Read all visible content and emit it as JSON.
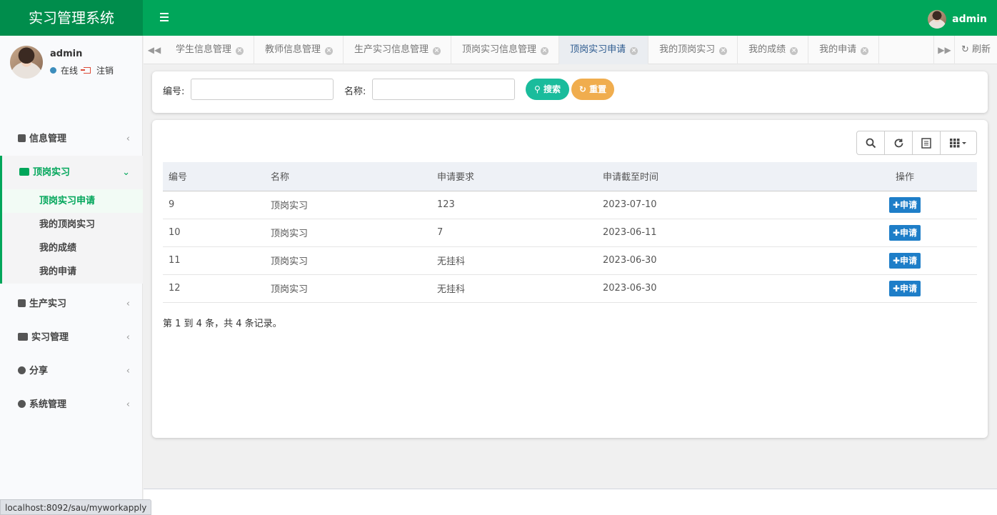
{
  "app": {
    "title": "实习管理系统"
  },
  "header": {
    "username": "admin"
  },
  "user_panel": {
    "name": "admin",
    "online": "在线",
    "logout": "注销"
  },
  "menu": {
    "info": "信息管理",
    "dingang": "顶岗实习",
    "dingang_sub": [
      "顶岗实习申请",
      "我的顶岗实习",
      "我的成绩",
      "我的申请"
    ],
    "shengchan": "生产实习",
    "shixi": "实习管理",
    "share": "分享",
    "system": "系统管理"
  },
  "tabs": [
    "学生信息管理",
    "教师信息管理",
    "生产实习信息管理",
    "顶岗实习信息管理",
    "顶岗实习申请",
    "我的顶岗实习",
    "我的成绩",
    "我的申请"
  ],
  "tab_refresh": "刷新",
  "search": {
    "id_label": "编号:",
    "name_label": "名称:",
    "id_value": "",
    "name_value": "",
    "search_btn": "搜索",
    "reset_btn": "重置"
  },
  "table": {
    "headers": [
      "编号",
      "名称",
      "申请要求",
      "申请截至时间",
      "操作"
    ],
    "rows": [
      {
        "id": "9",
        "name": "顶岗实习",
        "req": "123",
        "deadline": "2023-07-10",
        "action": "申请"
      },
      {
        "id": "10",
        "name": "顶岗实习",
        "req": "7",
        "deadline": "2023-06-11",
        "action": "申请"
      },
      {
        "id": "11",
        "name": "顶岗实习",
        "req": "无挂科",
        "deadline": "2023-06-30",
        "action": "申请"
      },
      {
        "id": "12",
        "name": "顶岗实习",
        "req": "无挂科",
        "deadline": "2023-06-30",
        "action": "申请"
      }
    ],
    "pager": "第 1 到 4 条，共 4 条记录。"
  },
  "statusbar": {
    "url": "localhost:8092/sau/myworkapply"
  },
  "colors": {
    "brand": "#00a65a",
    "brand_dark": "#008d4c",
    "search": "#1abc9c",
    "reset": "#f0ad4e",
    "apply": "#1e7ec8"
  }
}
